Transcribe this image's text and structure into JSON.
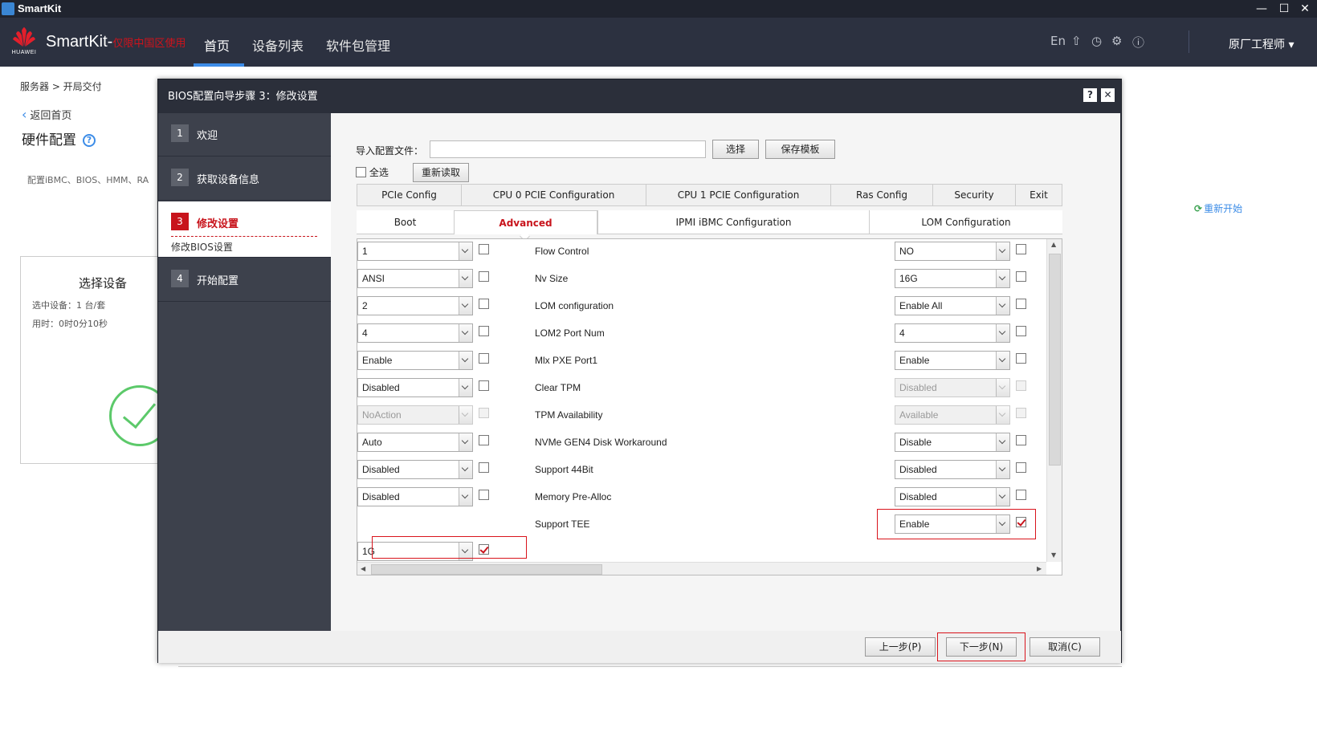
{
  "window": {
    "title": "SmartKit"
  },
  "header": {
    "brand_logo": "HUAWEI",
    "brand": "SmartKit-",
    "brand_note": "仅限中国区使用",
    "nav": [
      "首页",
      "设备列表",
      "软件包管理"
    ],
    "lang": "En",
    "icons": [
      "upload-icon",
      "clock-icon",
      "gear-icon",
      "help-icon"
    ],
    "user": "原厂工程师"
  },
  "page": {
    "breadcrumb": "服务器 > 开局交付",
    "back": "返回首页",
    "title": "硬件配置",
    "description": "配置iBMC、BIOS、HMM、RA",
    "device_card": {
      "title": "选择设备",
      "selected": "选中设备：1 台/套",
      "elapsed": "用时：0时0分10秒"
    },
    "restart": "重新开始"
  },
  "dialog": {
    "title": "BIOS配置向导步骤 3：修改设置",
    "steps": [
      {
        "num": "1",
        "label": "欢迎"
      },
      {
        "num": "2",
        "label": "获取设备信息"
      },
      {
        "num": "3",
        "label": "修改设置",
        "sub": "修改BIOS设置"
      },
      {
        "num": "4",
        "label": "开始配置"
      }
    ],
    "import_label": "导入配置文件：",
    "import_value": "",
    "choose": "选择",
    "save_template": "保存模板",
    "select_all": "全选",
    "reload": "重新读取",
    "tabs_row1": [
      "PCIe Config",
      "CPU 0 PCIE Configuration",
      "CPU 1 PCIE Configuration",
      "Ras Config",
      "Security",
      "Exit"
    ],
    "tabs_row2": [
      "Boot",
      "Advanced",
      "IPMI iBMC Configuration",
      "LOM Configuration"
    ],
    "active_tab": "Advanced",
    "rows": [
      {
        "left": "1",
        "name": "Flow Control",
        "right": "NO"
      },
      {
        "left": "ANSI",
        "name": "Nv Size",
        "right": "16G"
      },
      {
        "left": "2",
        "name": "LOM configuration",
        "right": "Enable All"
      },
      {
        "left": "4",
        "name": "LOM2 Port Num",
        "right": "4"
      },
      {
        "left": "Enable",
        "name": "Mlx PXE Port1",
        "right": "Enable"
      },
      {
        "left": "Disabled",
        "name": "Clear TPM",
        "right": "Disabled"
      },
      {
        "left": "NoAction",
        "name": "TPM Availability",
        "right": "Available"
      },
      {
        "left": "Auto",
        "name": "NVMe GEN4 Disk Workaround",
        "right": "Disable"
      },
      {
        "left": "Disabled",
        "name": "Support 44Bit",
        "right": "Disabled"
      },
      {
        "left": "Disabled",
        "name": "Memory Pre-Alloc",
        "right": "Disabled"
      },
      {
        "left": "",
        "name": "Support TEE",
        "right": "Enable"
      },
      {
        "left": "1G",
        "name": "",
        "right": ""
      }
    ],
    "footer": {
      "prev": "上一步(P)",
      "next": "下一步(N)",
      "cancel": "取消(C)"
    }
  }
}
